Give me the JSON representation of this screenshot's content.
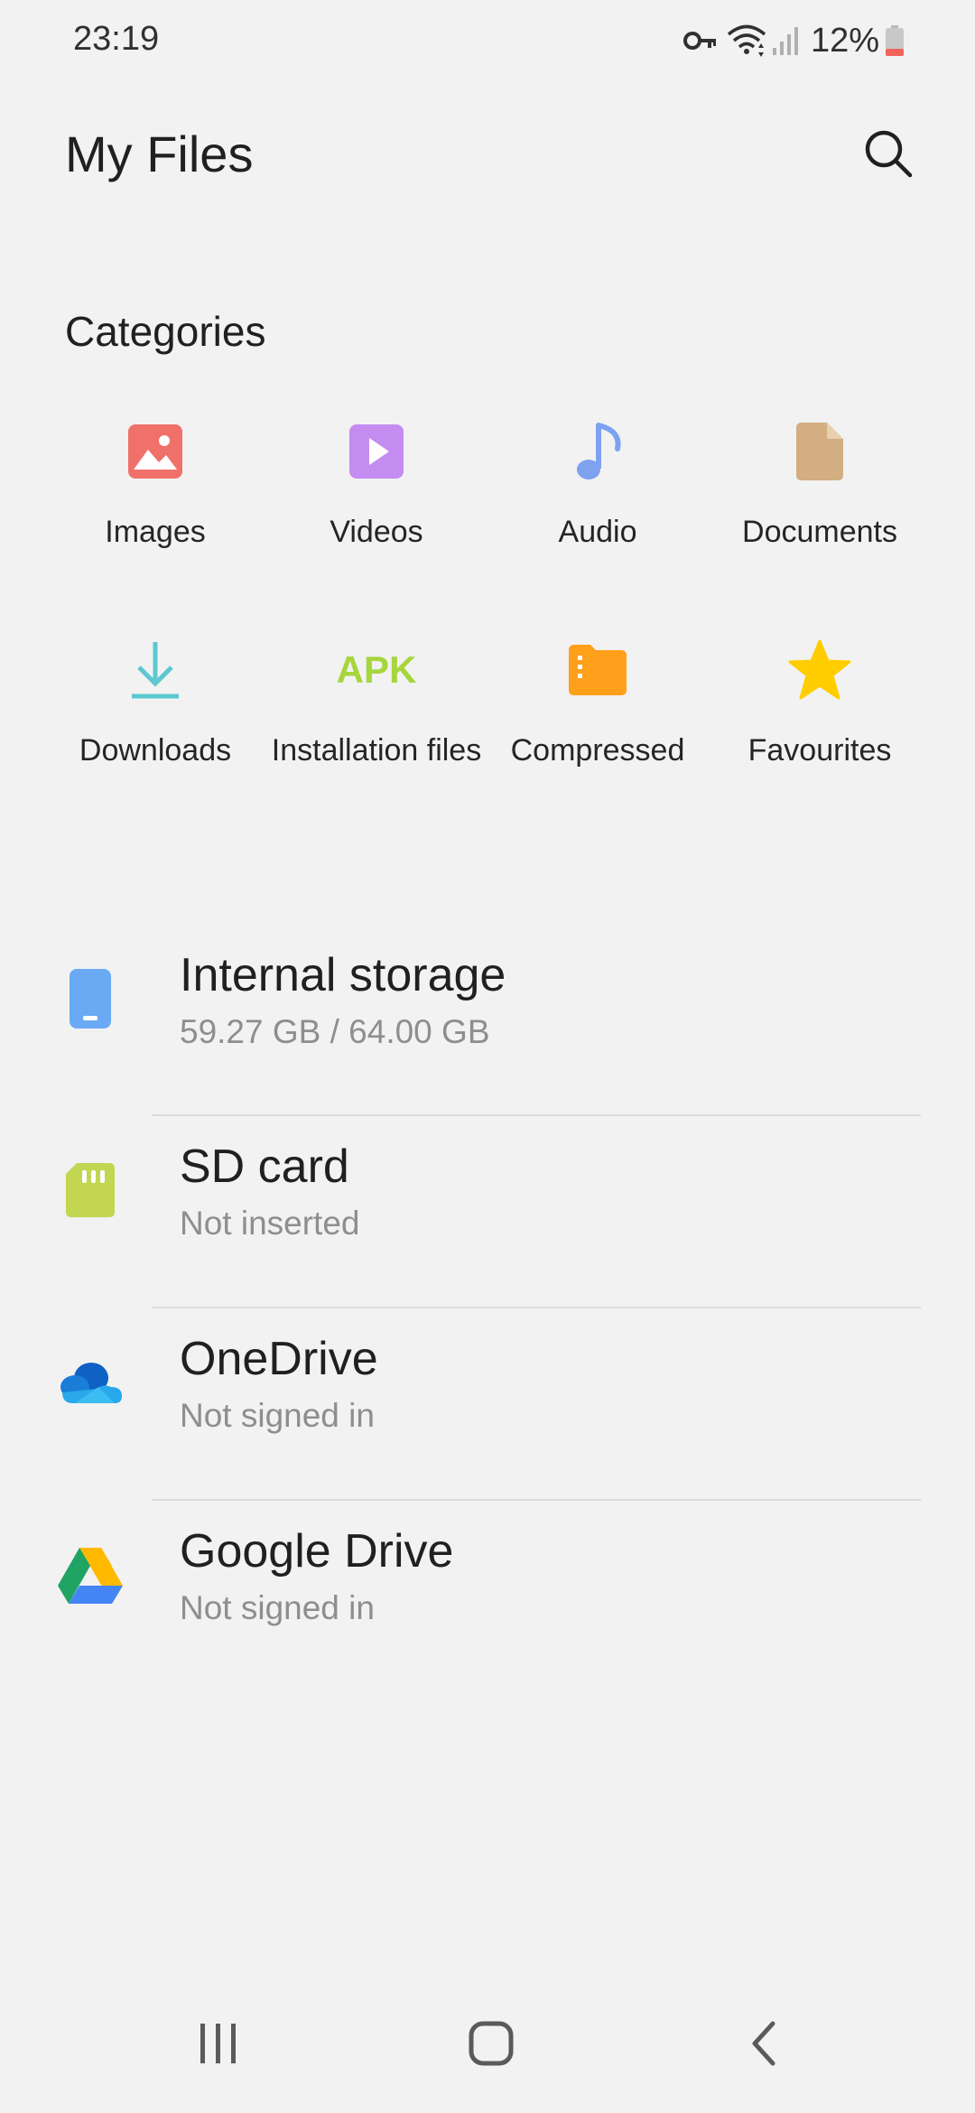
{
  "status_bar": {
    "time": "23:19",
    "battery_percent": "12%",
    "icons": [
      "vpn-key-icon",
      "wifi-icon",
      "signal-icon",
      "battery-icon"
    ]
  },
  "header": {
    "title": "My Files",
    "search_icon": "search-icon"
  },
  "categories": {
    "title": "Categories",
    "items": [
      {
        "label": "Images",
        "icon": "image-icon",
        "color": "#f0706a"
      },
      {
        "label": "Videos",
        "icon": "video-icon",
        "color": "#c48cf0"
      },
      {
        "label": "Audio",
        "icon": "music-note-icon",
        "color": "#7ea2f0"
      },
      {
        "label": "Documents",
        "icon": "document-icon",
        "color": "#d2ae82"
      },
      {
        "label": "Downloads",
        "icon": "download-icon",
        "color": "#5cc8d0"
      },
      {
        "label": "Installation files",
        "icon": "apk-icon",
        "icon_text": "APK",
        "color": "#a6d63c"
      },
      {
        "label": "Compressed",
        "icon": "compressed-folder-icon",
        "color": "#ff9f1a"
      },
      {
        "label": "Favourites",
        "icon": "star-icon",
        "color": "#ffcd00"
      }
    ]
  },
  "storage": [
    {
      "title": "Internal storage",
      "subtitle": "59.27 GB / 64.00 GB",
      "icon": "phone-icon",
      "color": "#6aaaf5"
    },
    {
      "title": "SD card",
      "subtitle": "Not inserted",
      "icon": "sd-card-icon",
      "color": "#c2d651"
    },
    {
      "title": "OneDrive",
      "subtitle": "Not signed in",
      "icon": "onedrive-icon",
      "color": "#0f78d4"
    },
    {
      "title": "Google Drive",
      "subtitle": "Not signed in",
      "icon": "google-drive-icon",
      "color": "#1fa463"
    }
  ],
  "nav_bar": {
    "recents_icon": "recents-icon",
    "home_icon": "home-icon",
    "back_icon": "back-icon"
  }
}
